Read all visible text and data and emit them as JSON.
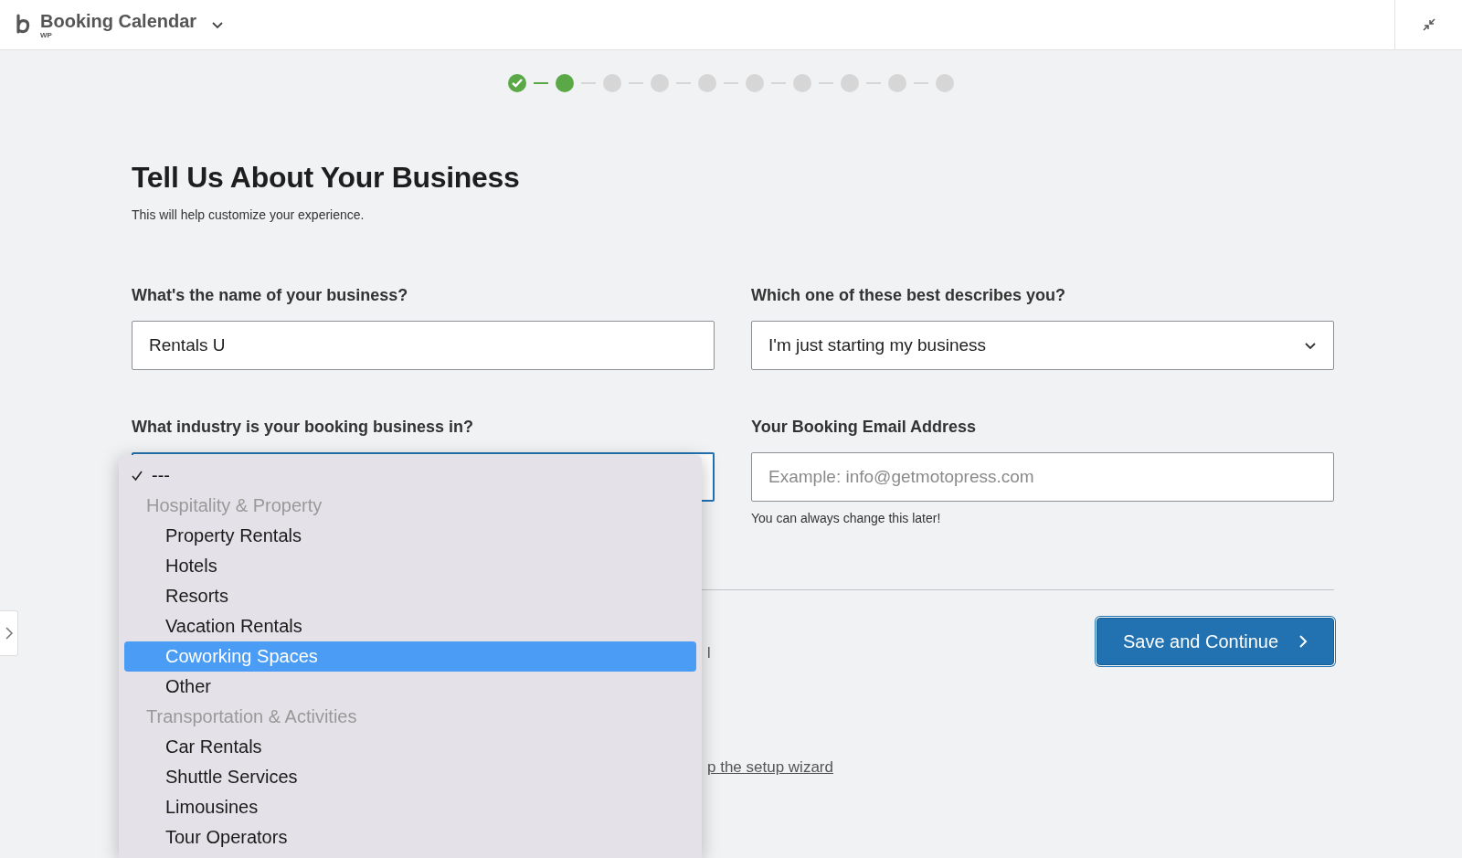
{
  "header": {
    "title": "Booking Calendar",
    "subtitle": "WP"
  },
  "steps": [
    {
      "completed": true,
      "current": false
    },
    {
      "completed": false,
      "current": true
    },
    {
      "completed": false,
      "current": false
    },
    {
      "completed": false,
      "current": false
    },
    {
      "completed": false,
      "current": false
    },
    {
      "completed": false,
      "current": false
    },
    {
      "completed": false,
      "current": false
    },
    {
      "completed": false,
      "current": false
    },
    {
      "completed": false,
      "current": false
    },
    {
      "completed": false,
      "current": false
    }
  ],
  "heading": "Tell Us About Your Business",
  "subheading": "This will help customize your experience.",
  "fields": [
    {
      "label": "What's the name of your business?",
      "kind": "text",
      "value": "Rentals U"
    },
    {
      "label": "Which one of these best describes you?",
      "kind": "select",
      "value": "I'm just starting my business"
    },
    {
      "label": "What industry is your booking business in?",
      "kind": "open-select",
      "focused": true
    },
    {
      "label": "Your Booking Email Address",
      "kind": "email",
      "placeholder": "Example: info@getmotopress.com",
      "hint": "You can always change this later!"
    }
  ],
  "industry_menu": [
    {
      "label": "---",
      "kind": "option",
      "checked": true,
      "selected": false
    },
    {
      "label": "Hospitality & Property",
      "kind": "group",
      "children": [
        {
          "label": "Property Rentals",
          "selected": false
        },
        {
          "label": "Hotels",
          "selected": false
        },
        {
          "label": "Resorts",
          "selected": false
        },
        {
          "label": "Vacation Rentals",
          "selected": false
        },
        {
          "label": "Coworking Spaces",
          "selected": true
        },
        {
          "label": "Other",
          "selected": false
        }
      ]
    },
    {
      "label": "Transportation & Activities",
      "kind": "group",
      "children": [
        {
          "label": "Car Rentals",
          "selected": false
        },
        {
          "label": "Shuttle Services",
          "selected": false
        },
        {
          "label": "Limousines",
          "selected": false
        },
        {
          "label": "Tour Operators",
          "selected": false
        }
      ]
    }
  ],
  "hidden_text_fragment": "l",
  "save_button": "Save and Continue",
  "skip_link": "p the setup wizard"
}
